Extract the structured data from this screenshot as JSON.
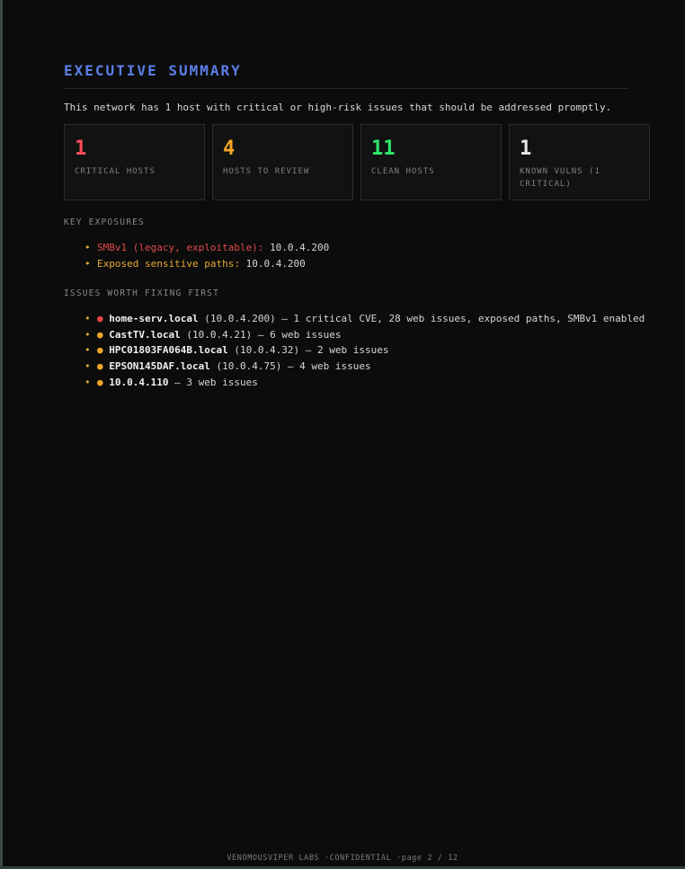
{
  "summary": {
    "title": "EXECUTIVE SUMMARY",
    "intro": "This network has 1 host with critical or high-risk issues that should be addressed promptly."
  },
  "stats": [
    {
      "value": "1",
      "label": "CRITICAL HOSTS",
      "color": "#ff4d57"
    },
    {
      "value": "4",
      "label": "HOSTS TO REVIEW",
      "color": "#f5a623"
    },
    {
      "value": "11",
      "label": "CLEAN HOSTS",
      "color": "#2ee86a"
    },
    {
      "value": "1",
      "label": "KNOWN VULNS (1 CRITICAL)",
      "color": "#e8e8e6"
    }
  ],
  "exposures": {
    "heading": "KEY EXPOSURES",
    "items": [
      {
        "label": "SMBv1 (legacy, exploitable):",
        "value": "10.0.4.200",
        "severity": "critical"
      },
      {
        "label": "Exposed sensitive paths:",
        "value": "10.0.4.200",
        "severity": "warning"
      }
    ]
  },
  "issues": {
    "heading": "ISSUES WORTH FIXING FIRST",
    "items": [
      {
        "severity": "critical",
        "host": "home-serv.local",
        "detail": " (10.0.4.200) — 1 critical CVE, 28 web issues, exposed paths, SMBv1 enabled"
      },
      {
        "severity": "warning",
        "host": "CastTV.local",
        "detail": " (10.0.4.21) — 6 web issues"
      },
      {
        "severity": "warning",
        "host": "HPC01803FA064B.local",
        "detail": " (10.0.4.32) — 2 web issues"
      },
      {
        "severity": "warning",
        "host": "EPSON145DAF.local",
        "detail": " (10.0.4.75) — 4 web issues"
      },
      {
        "severity": "warning",
        "host": "10.0.4.110",
        "detail": " — 3 web issues"
      }
    ]
  },
  "footer": {
    "org": "VENOMOUSVIPER LABS",
    "classification": "·CONFIDENTIAL",
    "page": "·page 2 / 12"
  }
}
